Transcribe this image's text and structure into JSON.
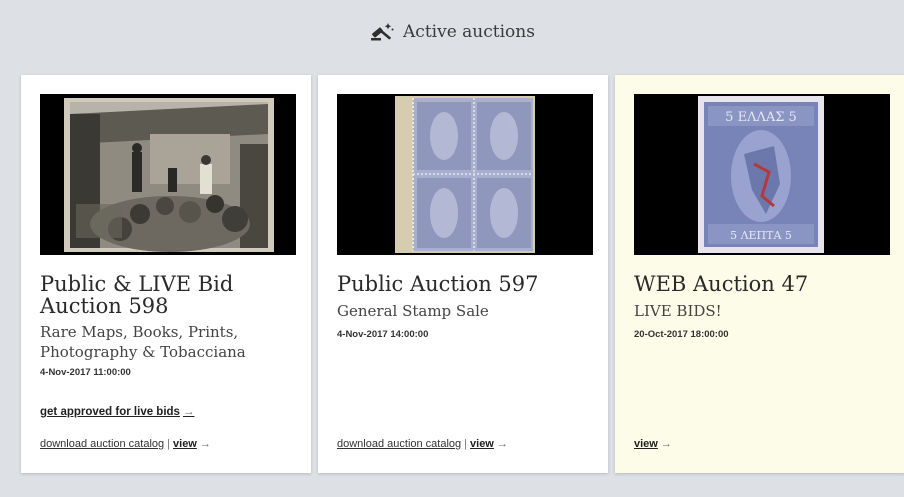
{
  "header": {
    "title": "Active auctions",
    "icon": "gavel-icon"
  },
  "auctions": [
    {
      "title": "Public & LIVE Bid Auction 598",
      "subtitle": "Rare Maps, Books, Prints, Photography & Tobacciana",
      "date": "4-Nov-2017 11:00:00",
      "approve_label": "get approved for live bids",
      "approve_arrow": "→",
      "download_label": "download auction catalog",
      "separator": "|",
      "view_label": "view",
      "view_arrow": "→"
    },
    {
      "title": "Public Auction 597",
      "subtitle": "General Stamp Sale",
      "date": "4-Nov-2017 14:00:00",
      "download_label": "download auction catalog",
      "separator": "|",
      "view_label": "view",
      "view_arrow": "→"
    },
    {
      "title": "WEB Auction 47",
      "subtitle": "LIVE BIDS!",
      "date": "20-Oct-2017 18:00:00",
      "view_label": "view",
      "view_arrow": "→",
      "highlight_color": "#fdfce8"
    }
  ],
  "stamp_labels": {
    "top": "5 ΕΛΛΑΣ 5",
    "bottom": "5 ΛΕΠΤΑ 5"
  }
}
